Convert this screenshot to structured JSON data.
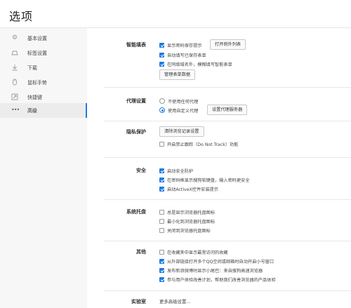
{
  "title": "选项",
  "sidebar": {
    "items": [
      {
        "label": "基本设置",
        "icon": "gear-icon"
      },
      {
        "label": "标签设置",
        "icon": "tab-icon"
      },
      {
        "label": "下载",
        "icon": "download-icon"
      },
      {
        "label": "鼠标手势",
        "icon": "mouse-icon"
      },
      {
        "label": "快捷键",
        "icon": "shortcut-icon"
      },
      {
        "label": "高级",
        "icon": "more-icon"
      }
    ],
    "active_index": 5
  },
  "sections": {
    "autofill": {
      "label": "智能填表",
      "opt1": "显示密码保存提示",
      "opt1_button": "打开例外列表",
      "opt2": "自动填写已保存表单",
      "opt3": "在同级域名外，模糊填写智能表单",
      "manage_button": "管理表单数据"
    },
    "proxy": {
      "label": "代理设置",
      "opt1": "不使用任何代理",
      "opt2": "使用自定义代理",
      "settings_button": "设置代理服务器"
    },
    "privacy": {
      "label": "隐私保护",
      "clear_button": "清除浏览记录设置",
      "opt1": "开启禁止跟踪（Do Not Track）功能"
    },
    "security": {
      "label": "安全",
      "opt1": "启动安全防护",
      "opt2": "在密码框显示搜狗软键盘，输入密码更安全",
      "opt3": "启动ActiveX控件安装提示"
    },
    "tray": {
      "label": "系统托盘",
      "opt1": "总是显示浏览器托盘图标",
      "opt2": "最小化到浏览器托盘图标",
      "opt3": "关闭到浏览器托盘图标"
    },
    "other": {
      "label": "其他",
      "opt1": "在收藏夹中显示最常访问的收藏",
      "opt2": "从外部链接打开多个QQ空间或邮箱时自动开启小号窗口",
      "opt3": "发布新浪微博时显示小尾巴：来自搜狗高速浏览器",
      "opt4": "参与用户体验改善计划，帮助我们改善浏览器的产品体验"
    },
    "lab": {
      "label": "实验室",
      "link": "更多高级设置..."
    }
  },
  "colors": {
    "accent": "#1f7ae0",
    "sidebar_bg": "#f7f7f7",
    "divider": "#e8e8e8"
  }
}
